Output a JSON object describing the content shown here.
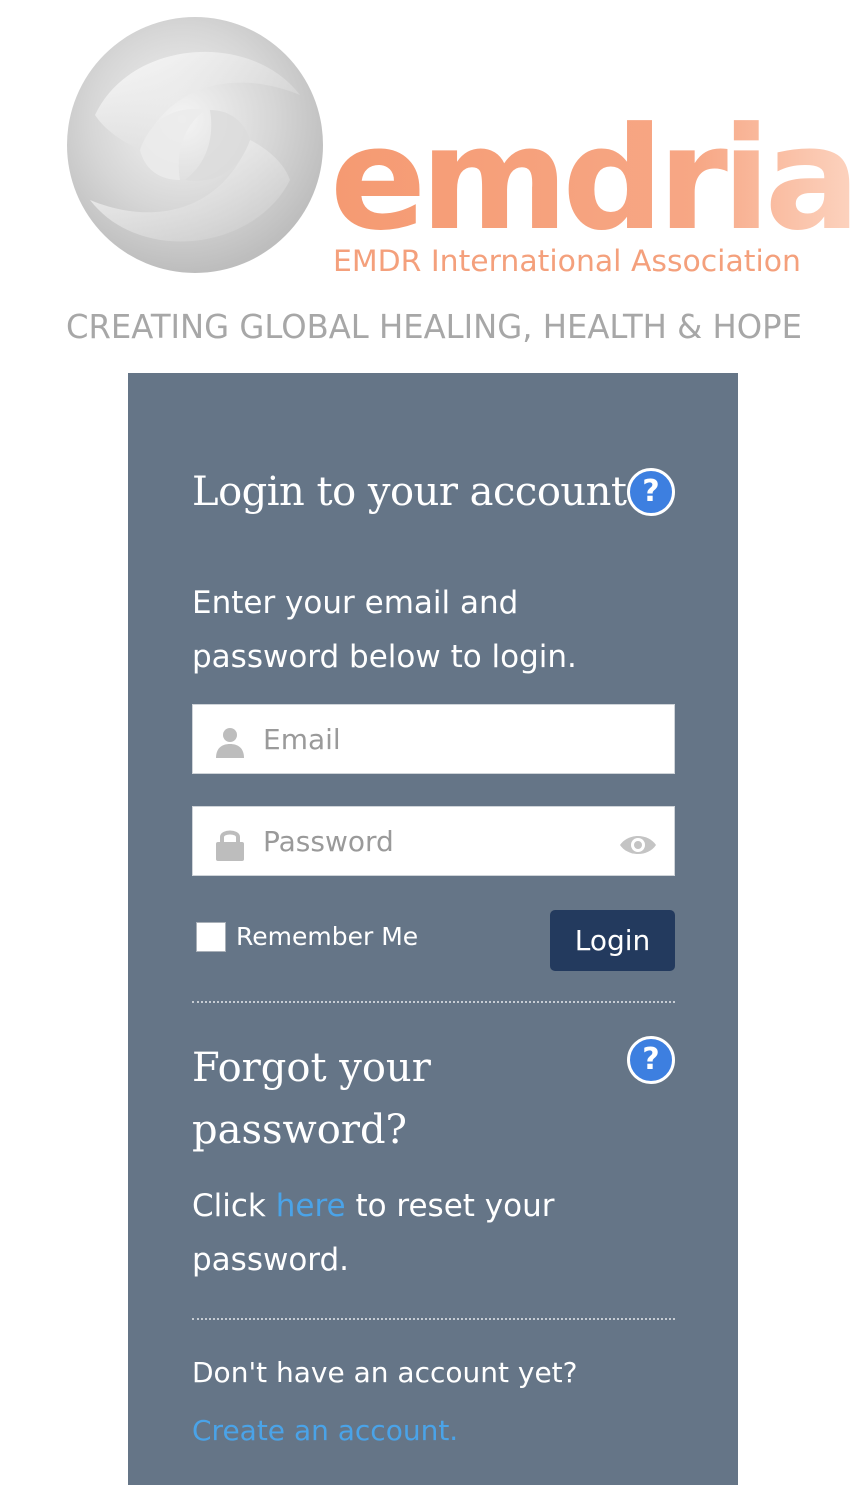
{
  "brand": {
    "logo_wordmark": "emdria",
    "logo_subtitle": "EMDR International Association",
    "tagline": "CREATING GLOBAL HEALING, HEALTH & HOPE",
    "accent_color": "#f4a07c",
    "card_color": "#657587",
    "button_color": "#233a5e",
    "link_color": "#4aa3e8"
  },
  "login": {
    "heading": "Login to your account",
    "help_icon": "question-circle-icon",
    "intro": "Enter your email and password below to login.",
    "email_placeholder": "Email",
    "email_value": "",
    "email_icon": "user-icon",
    "password_placeholder": "Password",
    "password_value": "",
    "password_icon": "lock-icon",
    "show_password_icon": "eye-icon",
    "remember_label": "Remember Me",
    "remember_checked": false,
    "login_button": "Login"
  },
  "forgot": {
    "heading": "Forgot your password?",
    "text_before": "Click ",
    "link_text": "here",
    "text_after": " to reset your password."
  },
  "signup": {
    "prompt": "Don't have an account yet?",
    "link_text": "Create an account."
  }
}
